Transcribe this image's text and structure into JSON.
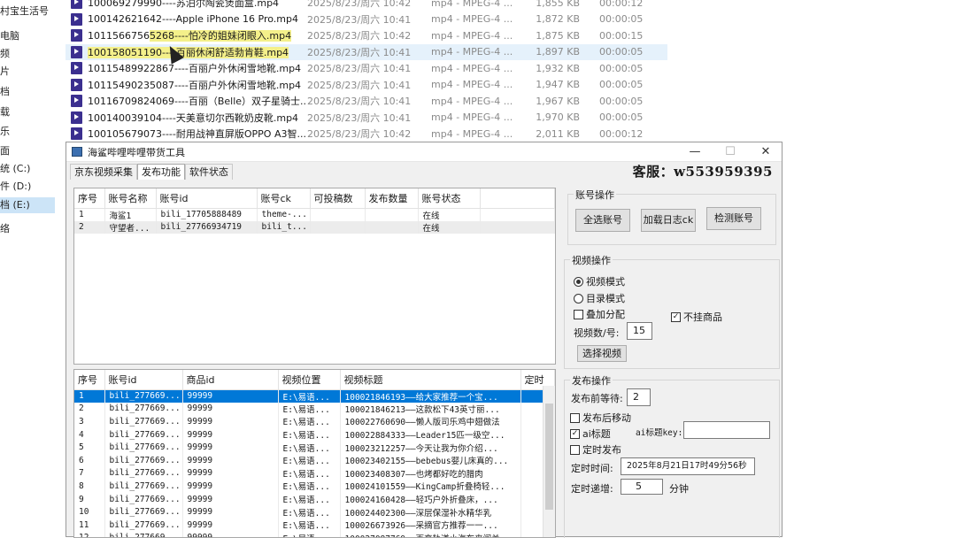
{
  "explorer": {
    "nav_items": [
      "村宝生活号",
      "电脑",
      "频",
      "片",
      "档",
      "载",
      "乐",
      "面",
      "统 (C:)",
      "件 (D:)",
      "档 (E:)",
      "络"
    ],
    "selected_nav": "档 (E:)",
    "files": [
      {
        "name": "100069279990----苏泊尔陶瓷煲面盒.mp4",
        "date": "2025/8/23/周六 10:42",
        "type": "mp4 - MPEG-4 ...",
        "size": "1,855 KB",
        "duration": "00:00:12"
      },
      {
        "name": "100142621642----Apple iPhone 16 Pro.mp4",
        "date": "2025/8/23/周六 10:41",
        "type": "mp4 - MPEG-4 ...",
        "size": "1,872 KB",
        "duration": "00:00:05"
      },
      {
        "name": "101156675652 68----怕冷的姐妹闭眼入.mp4",
        "name_prefix": "1011566756",
        "name_highlight": "5268----怕冷的姐妹闭眼入.mp4",
        "date": "2025/8/23/周六 10:42",
        "type": "mp4 - MPEG-4 ...",
        "size": "1,875 KB",
        "duration": "00:00:15"
      },
      {
        "name": "100158051190----百丽休闲舒适勃肯鞋.mp4",
        "name_prefix": "",
        "name_highlight": "100158051190----百丽休闲舒适勃肯鞋.mp4",
        "date": "2025/8/23/周六 10:41",
        "type": "mp4 - MPEG-4 ...",
        "size": "1,897 KB",
        "duration": "00:00:05"
      },
      {
        "name": "10115489922867----百丽户外休闲雪地靴.mp4",
        "date": "2025/8/23/周六 10:41",
        "type": "mp4 - MPEG-4 ...",
        "size": "1,932 KB",
        "duration": "00:00:05"
      },
      {
        "name": "10115490235087----百丽户外休闲雪地靴.mp4",
        "date": "2025/8/23/周六 10:41",
        "type": "mp4 - MPEG-4 ...",
        "size": "1,947 KB",
        "duration": "00:00:05"
      },
      {
        "name": "10116709824069----百丽（Belle）双子星骑士...",
        "date": "2025/8/23/周六 10:41",
        "type": "mp4 - MPEG-4 ...",
        "size": "1,967 KB",
        "duration": "00:00:05"
      },
      {
        "name": "100140039104----天美意切尔西靴奶皮靴.mp4",
        "date": "2025/8/23/周六 10:41",
        "type": "mp4 - MPEG-4 ...",
        "size": "1,970 KB",
        "duration": "00:00:05"
      },
      {
        "name": "100105679073----耐用战神直屏版OPPO A3智...",
        "date": "2025/8/23/周六 10:42",
        "type": "mp4 - MPEG-4 ...",
        "size": "2,011 KB",
        "duration": "00:00:12"
      }
    ]
  },
  "app": {
    "title": "海鲨哔哩哔哩带货工具",
    "window_controls": {
      "minimize": "—",
      "maximize": "☐",
      "close": "✕"
    },
    "tabs": [
      "京东视频采集",
      "发布功能",
      "软件状态"
    ],
    "active_tab": "发布功能",
    "service": "客服：w553959395",
    "accounts_table": {
      "headers": [
        "序号",
        "账号名称",
        "账号id",
        "账号ck",
        "可投稿数",
        "发布数量",
        "账号状态"
      ],
      "rows": [
        [
          "1",
          "海鲨1",
          "bili_17705888489",
          "theme-...",
          "",
          "",
          "在线"
        ],
        [
          "2",
          "守望者...",
          "bili_27766934719",
          "bili_t...",
          "",
          "",
          "在线"
        ]
      ]
    },
    "videos_table": {
      "headers": [
        "序号",
        "账号id",
        "商品id",
        "视频位置",
        "视频标题",
        "定时"
      ],
      "rows": [
        [
          "1",
          "bili_277669...",
          "99999",
          "E:\\易语...",
          "100021846193——给大家推荐一个宝..."
        ],
        [
          "2",
          "bili_277669...",
          "99999",
          "E:\\易语...",
          "100021846213——这款松下43英寸丽..."
        ],
        [
          "3",
          "bili_277669...",
          "99999",
          "E:\\易语...",
          "100022760690——懒人版司乐鸡中翅做法"
        ],
        [
          "4",
          "bili_277669...",
          "99999",
          "E:\\易语...",
          "100022884333——Leader15匹一级空..."
        ],
        [
          "5",
          "bili_277669...",
          "99999",
          "E:\\易语...",
          "100023212257——今天让我为你介绍..."
        ],
        [
          "6",
          "bili_277669...",
          "99999",
          "E:\\易语...",
          "100023402155——bebebus婴儿床真的..."
        ],
        [
          "7",
          "bili_277669...",
          "99999",
          "E:\\易语...",
          "100023408307——也烤都好吃的腊肉"
        ],
        [
          "8",
          "bili_277669...",
          "99999",
          "E:\\易语...",
          "100024101559——KingCamp折叠椅轻..."
        ],
        [
          "9",
          "bili_277669...",
          "99999",
          "E:\\易语...",
          "100024160428——轻巧户外折叠床，..."
        ],
        [
          "10",
          "bili_277669...",
          "99999",
          "E:\\易语...",
          "100024402300——深层保湿补水精华乳"
        ],
        [
          "11",
          "bili_277669...",
          "99999",
          "E:\\易语...",
          "100026673926——采摘官方推荐一一..."
        ],
        [
          "12",
          "bili_277669...",
          "99999",
          "E:\\易语...",
          "100027087769——百变轨道小汽车来闯关"
        ]
      ]
    },
    "account_ops": {
      "label": "账号操作",
      "select_all": "全选账号",
      "load_ck": "加载日志ck",
      "check": "检测账号"
    },
    "video_ops": {
      "label": "视频操作",
      "video_mode": "视频模式",
      "dir_mode": "目录模式",
      "overlay": "叠加分配",
      "no_goods": "不挂商品",
      "per_account_label": "视频数/号:",
      "per_account_value": "15",
      "select_video": "选择视频"
    },
    "publish_ops": {
      "label": "发布操作",
      "wait_label": "发布前等待:",
      "wait_value": "2",
      "move_after": "发布后移动",
      "ai_title": "ai标题",
      "ai_key_label": "ai标题key:",
      "ai_key_value": "",
      "scheduled": "定时发布",
      "sched_time_label": "定时时间:",
      "sched_time_value": "2025年8月21日17时49分56秒",
      "increment_label": "定时递增:",
      "increment_value": "5",
      "increment_unit": "分钟"
    }
  }
}
